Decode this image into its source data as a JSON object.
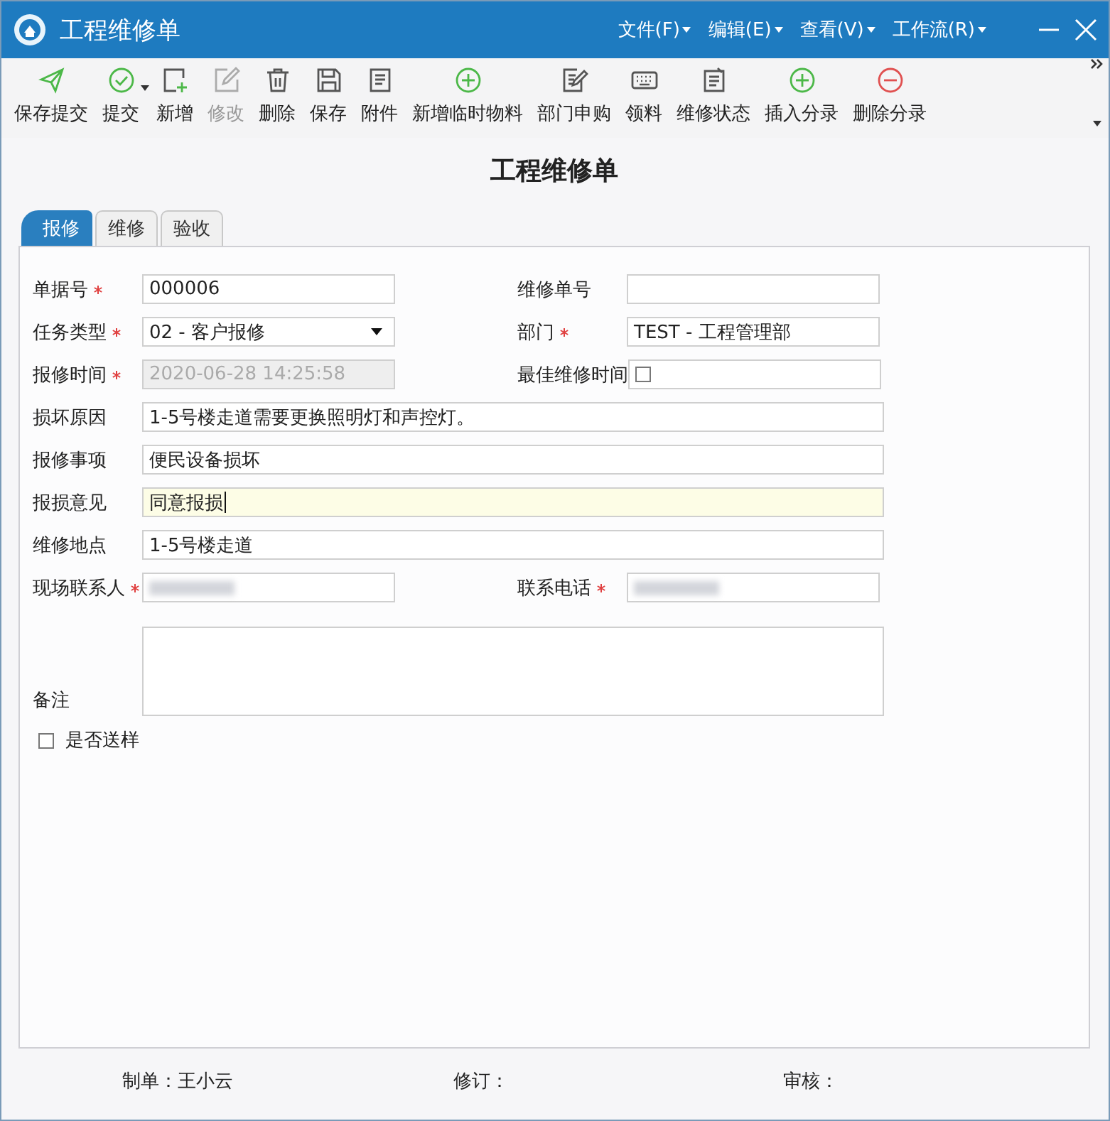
{
  "title_bar": {
    "title": "工程维修单",
    "menus": [
      "文件(F)",
      "编辑(E)",
      "查看(V)",
      "工作流(R)"
    ]
  },
  "toolbar": [
    {
      "label": "保存提交",
      "disabled": false,
      "dropdown": false
    },
    {
      "label": "提交",
      "disabled": false,
      "dropdown": true
    },
    {
      "label": "新增",
      "disabled": false,
      "dropdown": false
    },
    {
      "label": "修改",
      "disabled": true,
      "dropdown": false
    },
    {
      "label": "删除",
      "disabled": false,
      "dropdown": false
    },
    {
      "label": "保存",
      "disabled": false,
      "dropdown": false
    },
    {
      "label": "附件",
      "disabled": false,
      "dropdown": false
    },
    {
      "label": "新增临时物料",
      "disabled": false,
      "dropdown": false
    },
    {
      "label": "部门申购",
      "disabled": false,
      "dropdown": false
    },
    {
      "label": "领料",
      "disabled": false,
      "dropdown": false
    },
    {
      "label": "维修状态",
      "disabled": false,
      "dropdown": false
    },
    {
      "label": "插入分录",
      "disabled": false,
      "dropdown": false
    },
    {
      "label": "删除分录",
      "disabled": false,
      "dropdown": false
    }
  ],
  "form_title": "工程维修单",
  "tabs": [
    {
      "label": "报修",
      "selected": true
    },
    {
      "label": "维修",
      "selected": false
    },
    {
      "label": "验收",
      "selected": false
    }
  ],
  "rows": [
    [
      {
        "kind": "text",
        "label": "单据号",
        "required": true,
        "value": "000006"
      },
      {
        "kind": "text",
        "label": "维修单号",
        "required": false
      }
    ],
    [
      {
        "kind": "select",
        "label": "任务类型",
        "required": true,
        "value": "02 - 客户报修"
      },
      {
        "kind": "text",
        "label": "部门",
        "required": true,
        "value": "TEST - 工程管理部"
      }
    ],
    [
      {
        "kind": "text",
        "label": "报修时间",
        "required": true,
        "value": "2020-06-28 14:25:58",
        "disabled": true
      },
      {
        "kind": "checkbox",
        "label": "最佳维修时间",
        "required": false,
        "checked": false
      }
    ],
    [
      {
        "kind": "wide",
        "label": "损坏原因",
        "required": false,
        "value": "1-5号楼走道需要更换照明灯和声控灯。"
      }
    ],
    [
      {
        "kind": "wide",
        "label": "报修事项",
        "required": false,
        "value": "便民设备损坏"
      }
    ],
    [
      {
        "kind": "wide",
        "label": "报损意见",
        "required": false,
        "value": "同意报损",
        "focused": true
      }
    ],
    [
      {
        "kind": "wide",
        "label": "维修地点",
        "required": false,
        "value": "1-5号楼走道"
      }
    ],
    [
      {
        "kind": "text",
        "label": "现场联系人",
        "required": true,
        "redacted": true
      },
      {
        "kind": "text",
        "label": "联系电话",
        "required": true,
        "redacted": true
      }
    ],
    [
      {
        "kind": "textarea",
        "label": "备注",
        "required": false
      }
    ]
  ],
  "send_sample": {
    "label": "是否送样",
    "checked": false
  },
  "footer": [
    "制单：王小云",
    "修订：",
    "审核："
  ]
}
